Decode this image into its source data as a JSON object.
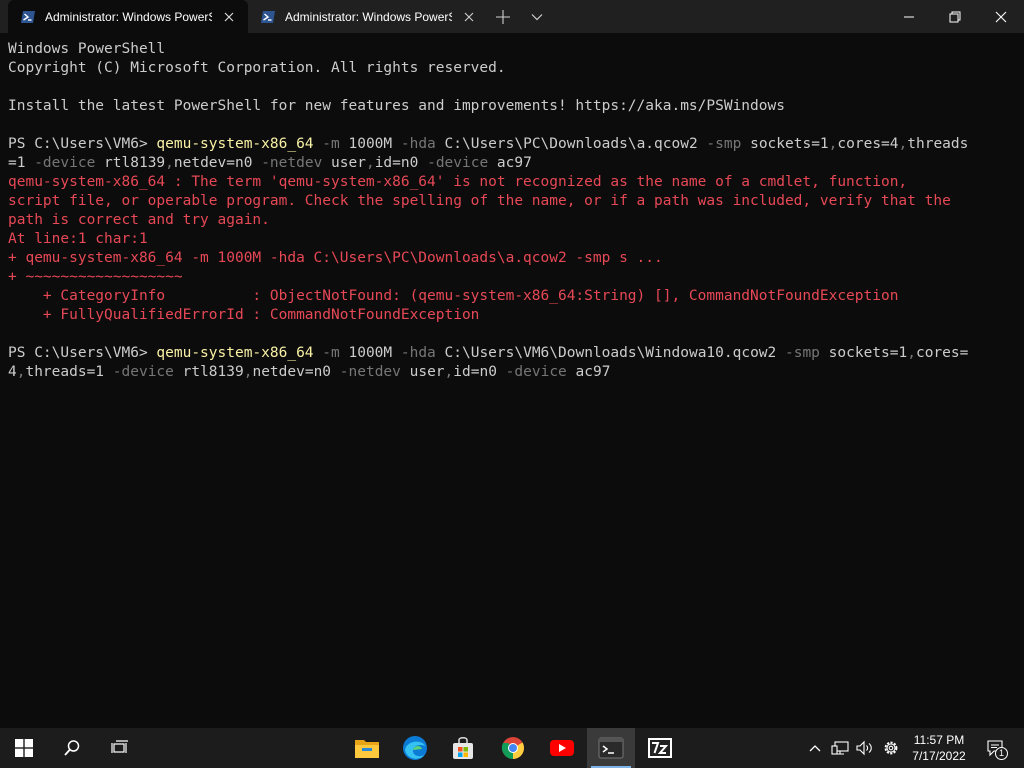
{
  "window": {
    "tabs": [
      {
        "title": "Administrator: Windows PowerShell",
        "active": true
      },
      {
        "title": "Administrator: Windows PowerShell",
        "active": false
      }
    ],
    "icons": {
      "tab": "powershell-icon",
      "close_tab": "close-icon",
      "new_tab": "plus-icon",
      "dropdown": "chevron-down-icon",
      "minimize": "minimize-icon",
      "maximize": "maximize-icon",
      "close_window": "close-icon"
    },
    "colors": {
      "titlebar": "#202020",
      "active_tab": "#0c0c0c"
    }
  },
  "console": {
    "colors": {
      "background": "#0c0c0c",
      "text": "#cccccc",
      "command": "#f9f1a5",
      "parameter": "#767676",
      "error": "#e74856"
    },
    "lines": [
      [
        {
          "t": "Windows PowerShell"
        }
      ],
      [
        {
          "t": "Copyright (C) Microsoft Corporation. All rights reserved."
        }
      ],
      [],
      [
        {
          "t": "Install the latest PowerShell for new features and improvements! https://aka.ms/PSWindows"
        }
      ],
      [],
      [
        {
          "t": "PS C:\\Users\\VM6> "
        },
        {
          "t": "qemu-system-x86_64",
          "c": "cmd"
        },
        {
          "t": " -m",
          "c": "param"
        },
        {
          "t": " 1000M"
        },
        {
          "t": " -hda",
          "c": "param"
        },
        {
          "t": " C:\\Users\\PC\\Downloads\\a.qcow2"
        },
        {
          "t": " -smp",
          "c": "param"
        },
        {
          "t": " sockets=1"
        },
        {
          "t": ",",
          "c": "param"
        },
        {
          "t": "cores=4"
        },
        {
          "t": ",",
          "c": "param"
        },
        {
          "t": "threads"
        }
      ],
      [
        {
          "t": "=1"
        },
        {
          "t": " -device",
          "c": "param"
        },
        {
          "t": " rtl8139"
        },
        {
          "t": ",",
          "c": "param"
        },
        {
          "t": "netdev=n0"
        },
        {
          "t": " -netdev",
          "c": "param"
        },
        {
          "t": " user"
        },
        {
          "t": ",",
          "c": "param"
        },
        {
          "t": "id=n0"
        },
        {
          "t": " -device",
          "c": "param"
        },
        {
          "t": " ac97"
        }
      ],
      [
        {
          "t": "qemu-system-x86_64 : The term 'qemu-system-x86_64' is not recognized as the name of a cmdlet, function,",
          "c": "err"
        }
      ],
      [
        {
          "t": "script file, or operable program. Check the spelling of the name, or if a path was included, verify that the",
          "c": "err"
        }
      ],
      [
        {
          "t": "path is correct and try again.",
          "c": "err"
        }
      ],
      [
        {
          "t": "At line:1 char:1",
          "c": "err"
        }
      ],
      [
        {
          "t": "+ qemu-system-x86_64 -m 1000M -hda C:\\Users\\PC\\Downloads\\a.qcow2 -smp s ...",
          "c": "err"
        }
      ],
      [
        {
          "t": "+ ~~~~~~~~~~~~~~~~~~",
          "c": "err"
        }
      ],
      [
        {
          "t": "    + CategoryInfo          : ObjectNotFound: (qemu-system-x86_64:String) [], CommandNotFoundException",
          "c": "err"
        }
      ],
      [
        {
          "t": "    + FullyQualifiedErrorId : CommandNotFoundException",
          "c": "err"
        }
      ],
      [],
      [
        {
          "t": "PS C:\\Users\\VM6> "
        },
        {
          "t": "qemu-system-x86_64",
          "c": "cmd"
        },
        {
          "t": " -m",
          "c": "param"
        },
        {
          "t": " 1000M"
        },
        {
          "t": " -hda",
          "c": "param"
        },
        {
          "t": " C:\\Users\\VM6\\Downloads\\Windowa10.qcow2"
        },
        {
          "t": " -smp",
          "c": "param"
        },
        {
          "t": " sockets=1"
        },
        {
          "t": ",",
          "c": "param"
        },
        {
          "t": "cores="
        }
      ],
      [
        {
          "t": "4"
        },
        {
          "t": ",",
          "c": "param"
        },
        {
          "t": "threads=1"
        },
        {
          "t": " -device",
          "c": "param"
        },
        {
          "t": " rtl8139"
        },
        {
          "t": ",",
          "c": "param"
        },
        {
          "t": "netdev=n0"
        },
        {
          "t": " -netdev",
          "c": "param"
        },
        {
          "t": " user"
        },
        {
          "t": ",",
          "c": "param"
        },
        {
          "t": "id=n0"
        },
        {
          "t": " -device",
          "c": "param"
        },
        {
          "t": " ac97"
        }
      ]
    ]
  },
  "taskbar": {
    "background": "#1c1c1c",
    "accent": "#7fb4e6",
    "left_icons": [
      "windows-start-icon",
      "search-icon",
      "task-view-icon"
    ],
    "pinned_apps": [
      "file-explorer-icon",
      "edge-icon",
      "microsoft-store-icon",
      "chrome-icon",
      "youtube-icon",
      "terminal-icon",
      "7zip-icon"
    ],
    "active_app": "terminal-icon",
    "tray_icons": [
      "chevron-up-icon",
      "network-icon",
      "volume-icon",
      "settings-gear-icon"
    ],
    "time": "11:57 PM",
    "date": "7/17/2022",
    "notification_count": "1"
  }
}
